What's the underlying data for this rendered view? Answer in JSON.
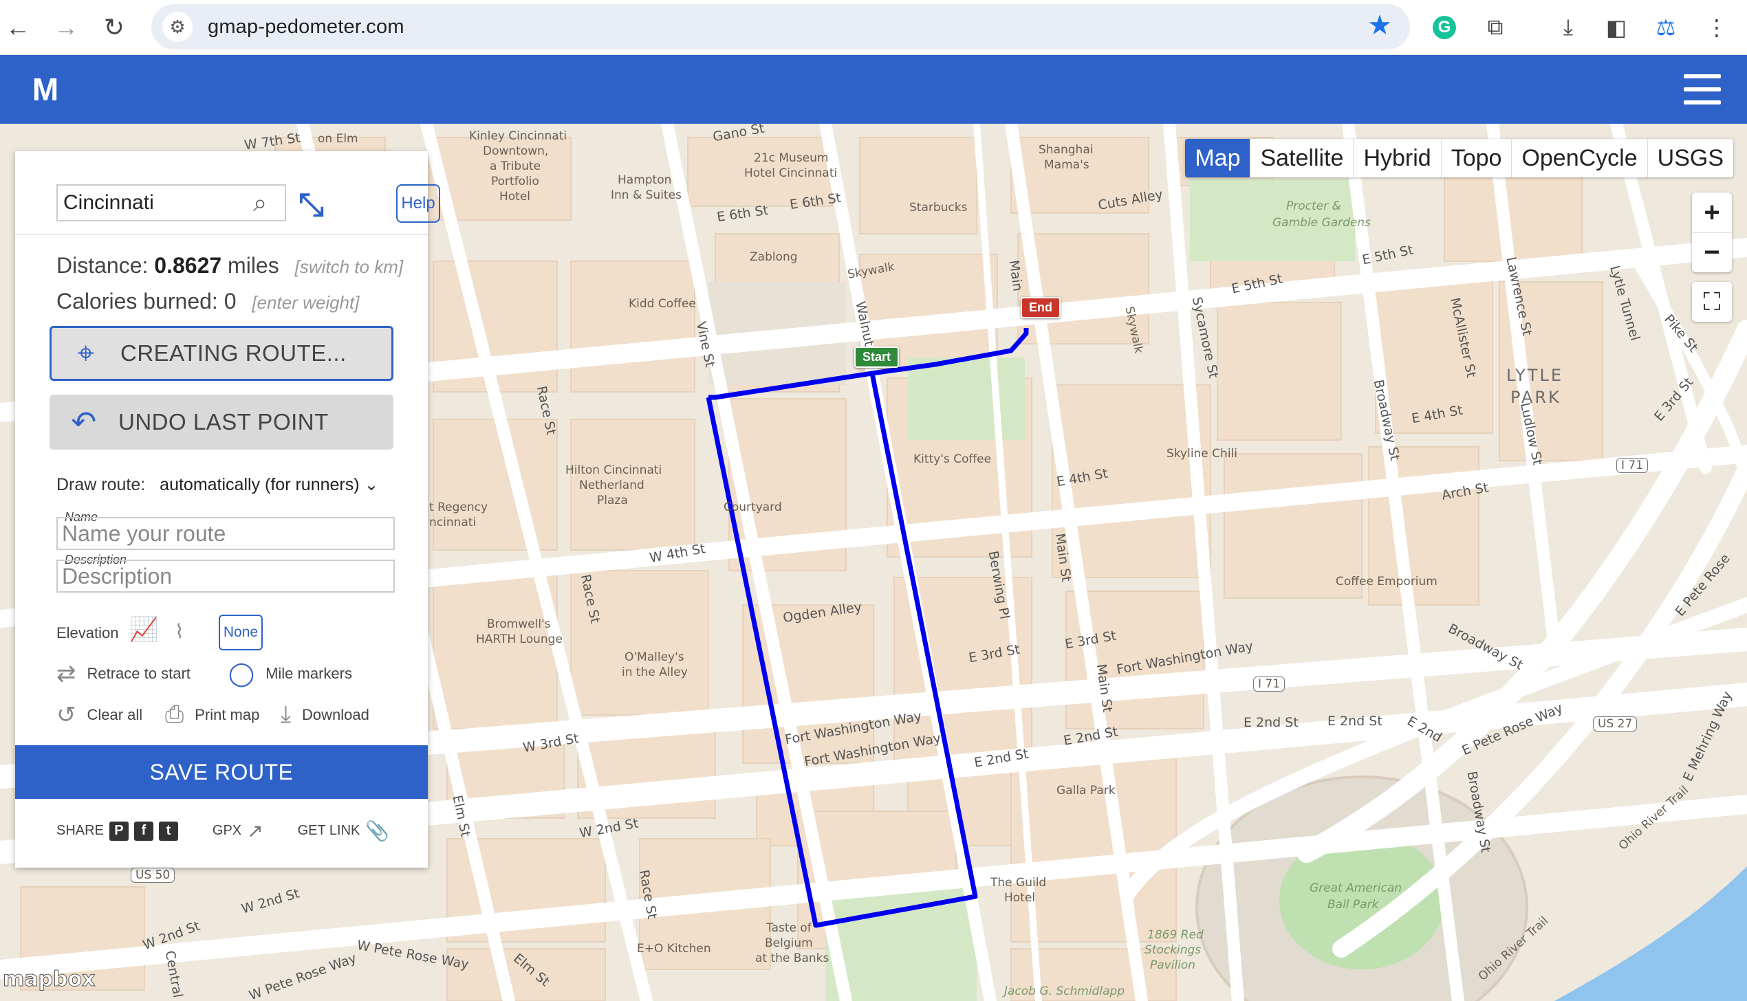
{
  "browser": {
    "url": "gmap-pedometer.com",
    "icons": [
      "back-icon",
      "forward-icon",
      "reload-icon",
      "site-settings-icon",
      "bookmark-star-icon",
      "grammarly-icon",
      "extensions-icon",
      "download-icon",
      "sidebar-icon",
      "profile-icon",
      "menu-icon"
    ],
    "accent": "#1a73e8"
  },
  "app": {
    "logo": "M",
    "brand_color": "#2e62c9"
  },
  "map": {
    "types": [
      "Map",
      "Satellite",
      "Hybrid",
      "Topo",
      "OpenCycle",
      "USGS"
    ],
    "active_type": "Map",
    "zoom_in": "+",
    "zoom_out": "−",
    "attribution": "mapbox",
    "route_color": "#0000ee",
    "markers": {
      "start": "Start",
      "end": "End"
    },
    "labels": {
      "w7th": "W 7th St",
      "onelm": "on Elm",
      "kinley": "Kinley Cincinnati",
      "kinley2": "Downtown,",
      "kinley3": "a Tribute",
      "kinley4": "Portfolio",
      "kinley5": "Hotel",
      "gano": "Gano St",
      "museum": "21c Museum",
      "museum2": "Hotel Cincinnati",
      "hampton": "Hampton",
      "hampton2": "Inn & Suites",
      "e6th_a": "E 6th St",
      "e6th_b": "E 6th St",
      "starbucks": "Starbucks",
      "shanghai": "Shanghai",
      "shanghai2": "Mama's",
      "cuts": "Cuts Alley",
      "zablong": "Zablong",
      "skywalk": "Skywalk",
      "kidd": "Kidd Coffee",
      "walnut": "Walnut",
      "main_n": "Main",
      "vine": "Vine St",
      "procter": "Procter &",
      "procter2": "Gamble Gardens",
      "e5th_a": "E 5th St",
      "e5th_b": "E 5th St",
      "skywalk2": "Skywalk",
      "sycamore": "Sycamore St",
      "broadway": "Broadway St",
      "mcallister": "McAllister St",
      "lawrence": "Lawrence St",
      "lytle_tunnel": "Lytle Tunnel",
      "lytle": "LYTLE",
      "park": "PARK",
      "pike": "Pike St",
      "e3rd_ne": "E 3rd St",
      "ludlow": "Ludlow St",
      "e4th_a": "E 4th St",
      "e4th_b": "E 4th St",
      "arch": "Arch St",
      "i71_a": "I 71",
      "race_n": "Race St",
      "hilton": "Hilton Cincinnati",
      "hilton2": "Netherland",
      "hilton3": "Plaza",
      "courtyard": "Courtyard",
      "kittys": "Kitty's Coffee",
      "skyline": "Skyline Chili",
      "regency": "t Regency",
      "regency2": "ncinnati",
      "w4th": "W 4th St",
      "race_m": "Race St",
      "bromwell": "Bromwell's",
      "bromwell2": "HARTH Lounge",
      "omalley": "O'Malley's",
      "omalley2": "in the Alley",
      "ogden": "Ogden Alley",
      "berwing": "Berwing Pl",
      "main_m": "Main St",
      "coffee_emp": "Coffee Emporium",
      "e_pete_rose_n": "E Pete Rose",
      "e3rd_a": "E 3rd St",
      "e3rd_b": "E 3rd St",
      "fortwash_a": "Fort Washington Way",
      "i71_b": "I 71",
      "broadway_way": "Broadway St",
      "fortwash_b": "Fort Washington Way",
      "fortwash_c": "Fort Washington Way",
      "main_s": "Main St",
      "e2nd_a": "E 2nd St",
      "e2nd_b": "E 2nd St",
      "e2nd_c": "E 2nd St",
      "e2nd_d": "E 2nd St",
      "e2nd_e": "E 2nd",
      "e_pete_rose_s": "E Pete Rose Way",
      "us27": "US 27",
      "mehring": "E Mehring Way",
      "w3rd": "W 3rd St",
      "galla": "Galla Park",
      "broadway_s": "Broadway St",
      "ohio_trail": "Ohio River Trail",
      "guild": "The Guild",
      "guild2": "Hotel",
      "elm": "Elm St",
      "w2nd_a": "W 2nd St",
      "w2nd_b": "W 2nd St",
      "us50": "US 50",
      "race_s": "Race St",
      "gabp": "Great American",
      "gabp2": "Ball Park",
      "w2nd_c": "W 2nd St",
      "taste": "Taste of",
      "taste2": "Belgium",
      "taste3": "at the Banks",
      "eo": "E+O Kitchen",
      "red1869": "1869 Red",
      "red1869b": "Stockings",
      "red1869c": "Pavilion",
      "ohio_trail2": "Ohio River Trail",
      "w_pete_rose": "W Pete Rose Way",
      "w_pete_rose2": "W Pete Rose Way",
      "elm_s": "Elm St",
      "central": "Central",
      "schmidlapp": "Jacob G. Schmidlapp"
    }
  },
  "panel": {
    "search_value": "Cincinnati",
    "help": "Help",
    "distance_label": "Distance:",
    "distance_value": "0.8627",
    "distance_unit": "miles",
    "switch_units": "[switch to km]",
    "calories_label": "Calories burned:",
    "calories_value": "0",
    "enter_weight": "[enter weight]",
    "creating_route": "CREATING ROUTE...",
    "undo": "UNDO LAST POINT",
    "draw_label": "Draw route:",
    "draw_value": "automatically (for runners)",
    "name_label": "Name",
    "name_placeholder": "Name your route",
    "desc_label": "Description",
    "desc_placeholder": "Description",
    "elevation": "Elevation",
    "none": "None",
    "retrace": "Retrace to start",
    "mile_markers": "Mile markers",
    "clear_all": "Clear all",
    "print_map": "Print map",
    "download": "Download",
    "save_route": "SAVE ROUTE",
    "share": "SHARE",
    "gpx": "GPX",
    "get_link": "GET LINK"
  }
}
